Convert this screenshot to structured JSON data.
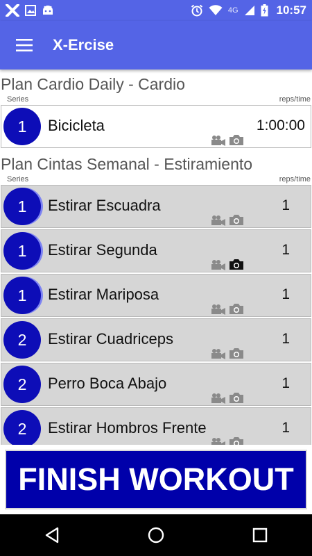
{
  "status_bar": {
    "time": "10:57",
    "network": "4G",
    "colors": {
      "bar": "#5464e6"
    }
  },
  "app_bar": {
    "title": "X-Ercise"
  },
  "plans": [
    {
      "title": "Plan Cardio Daily - Cardio",
      "col_left": "Series",
      "col_right": "reps/time",
      "exercises": [
        {
          "series": "1",
          "name": "Bicicleta",
          "reps": "1:00:00"
        }
      ]
    },
    {
      "title": "Plan Cintas Semanal - Estiramiento",
      "col_left": "Series",
      "col_right": "reps/time",
      "exercises": [
        {
          "series": "1",
          "name": "Estirar Escuadra",
          "reps": "1"
        },
        {
          "series": "1",
          "name": "Estirar Segunda",
          "reps": "1"
        },
        {
          "series": "1",
          "name": "Estirar Mariposa",
          "reps": "1"
        },
        {
          "series": "2",
          "name": "Estirar Cuadriceps",
          "reps": "1"
        },
        {
          "series": "2",
          "name": "Perro Boca Abajo",
          "reps": "1"
        },
        {
          "series": "2",
          "name": "Estirar Hombros Frente",
          "reps": "1"
        }
      ]
    }
  ],
  "finish_button": {
    "label": "FINISH WORKOUT",
    "color": "#0000aa"
  },
  "icons": {
    "video": "video-camera-icon",
    "photo": "photo-camera-icon"
  }
}
